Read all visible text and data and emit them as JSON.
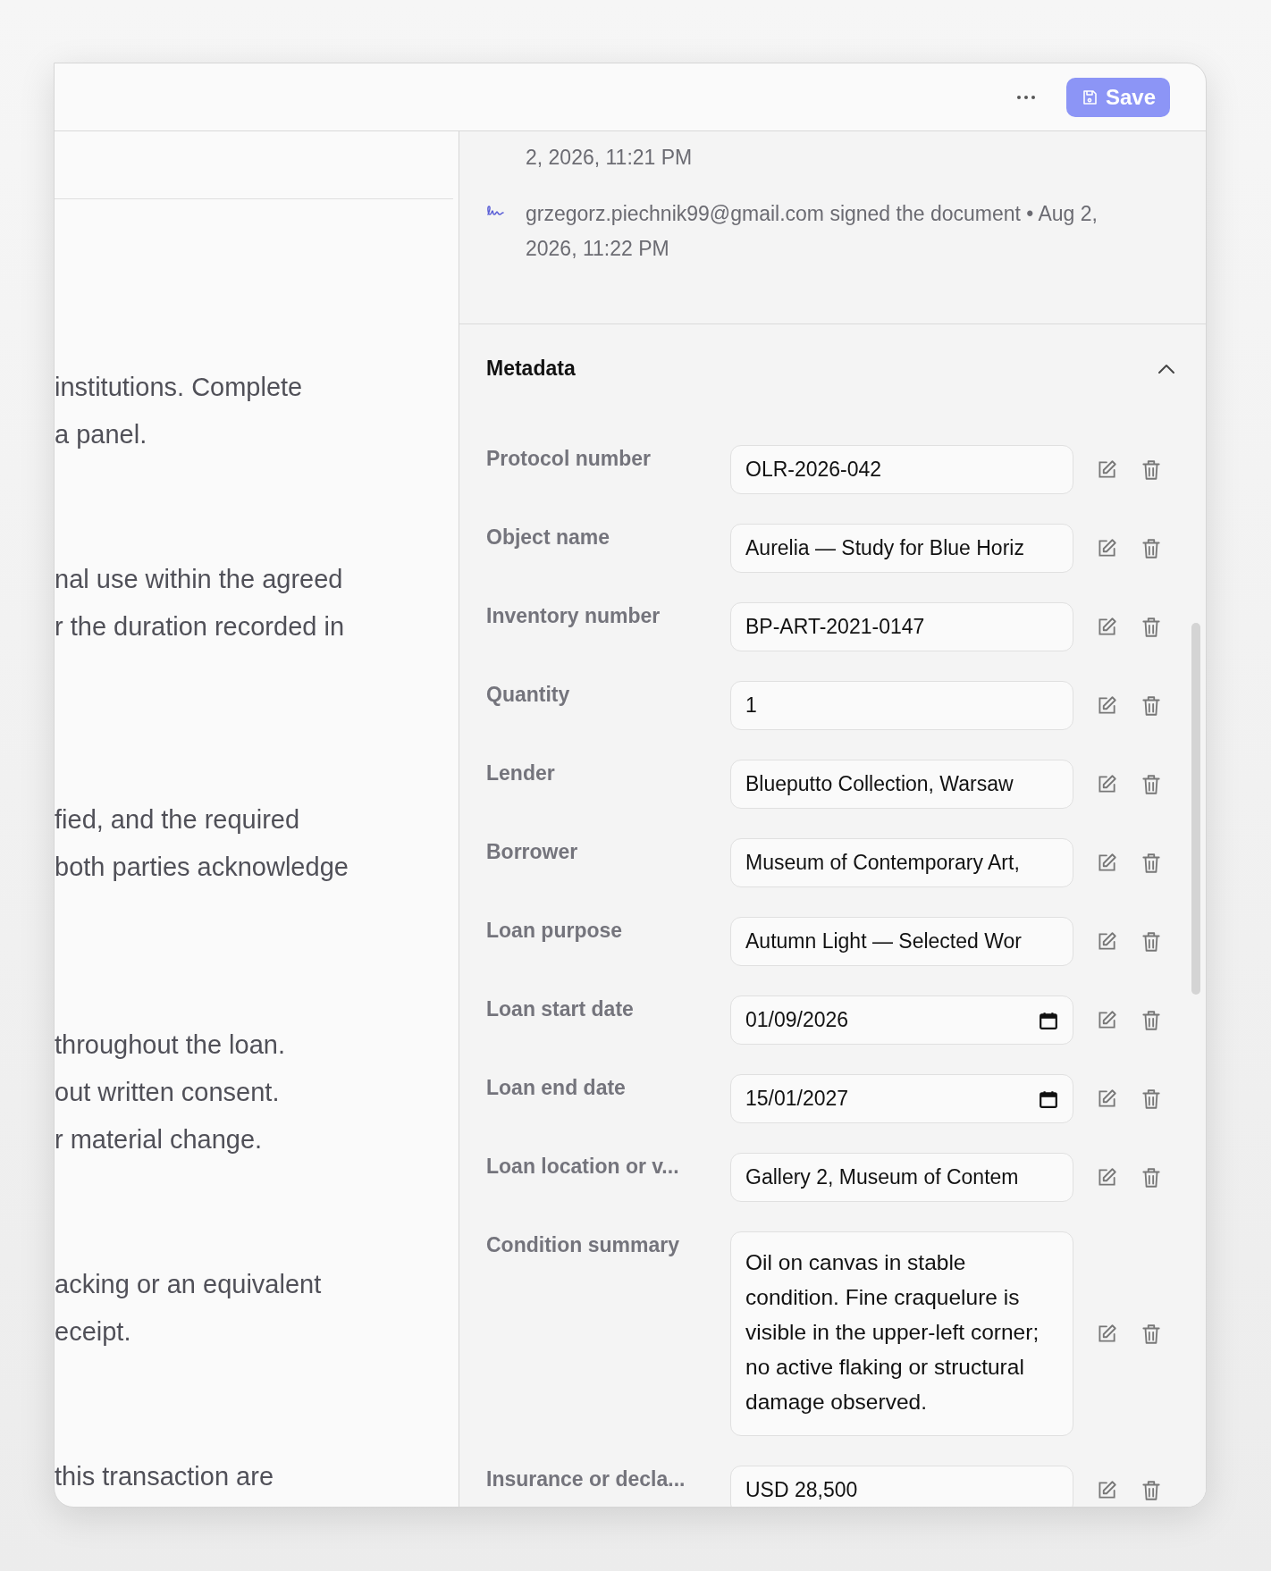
{
  "header": {
    "save_label": "Save"
  },
  "document": {
    "paragraphs": [
      [
        "institutions. Complete",
        "a panel."
      ],
      [
        "nal use within the agreed",
        "r the duration recorded in"
      ],
      [
        "fied, and the required",
        "both parties acknowledge"
      ],
      [
        "throughout the loan.",
        "out written consent.",
        "r material change."
      ],
      [
        "acking or an equivalent",
        "eceipt."
      ],
      [
        "this transaction are"
      ]
    ]
  },
  "activity": [
    {
      "kind": "continuation",
      "text": "2, 2026, 11:21 PM"
    },
    {
      "kind": "signed",
      "text": "grzegorz.piechnik99@gmail.com signed the document • Aug 2, 2026, 11:22 PM"
    }
  ],
  "metadata": {
    "title": "Metadata",
    "expanded": true,
    "fields": [
      {
        "kind": "text",
        "label": "Protocol number",
        "value": "OLR-2026-042"
      },
      {
        "kind": "text",
        "label": "Object name",
        "value": "Aurelia — Study for Blue Horiz"
      },
      {
        "kind": "text",
        "label": "Inventory number",
        "value": "BP-ART-2021-0147"
      },
      {
        "kind": "text",
        "label": "Quantity",
        "value": "1"
      },
      {
        "kind": "text",
        "label": "Lender",
        "value": "Blueputto Collection, Warsaw"
      },
      {
        "kind": "text",
        "label": "Borrower",
        "value": "Museum of Contemporary Art,"
      },
      {
        "kind": "text",
        "label": "Loan purpose",
        "value": "Autumn Light — Selected Wor"
      },
      {
        "kind": "date",
        "label": "Loan start date",
        "value": "01/09/2026"
      },
      {
        "kind": "date",
        "label": "Loan end date",
        "value": "15/01/2027"
      },
      {
        "kind": "text",
        "label": "Loan location or v...",
        "value": "Gallery 2, Museum of Contem"
      },
      {
        "kind": "textarea",
        "label": "Condition summary",
        "value": "Oil on canvas in stable condition. Fine craquelure is visible in the upper-left corner; no active flaking or structural damage observed."
      },
      {
        "kind": "text",
        "label": "Insurance or decla...",
        "value": "USD 28,500"
      }
    ]
  }
}
